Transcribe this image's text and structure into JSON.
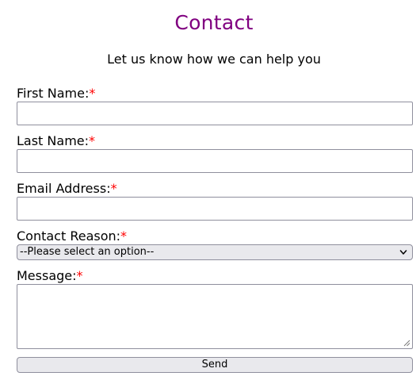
{
  "header": {
    "title": "Contact",
    "subtitle": "Let us know how we can help you"
  },
  "form": {
    "required_marker": "*",
    "first_name": {
      "label": "First Name:",
      "value": ""
    },
    "last_name": {
      "label": "Last Name:",
      "value": ""
    },
    "email": {
      "label": "Email Address:",
      "value": ""
    },
    "contact_reason": {
      "label": "Contact Reason:",
      "selected": "--Please select an option--"
    },
    "message": {
      "label": "Message:",
      "value": ""
    },
    "send_label": "Send"
  },
  "colors": {
    "title": "#800080",
    "required": "#ff0000",
    "control_bg": "#e9e9ed",
    "border": "#8f8f9d"
  },
  "icons": {
    "select_arrow": "chevron-down-icon",
    "resize_handle": "resize-grip-icon"
  }
}
